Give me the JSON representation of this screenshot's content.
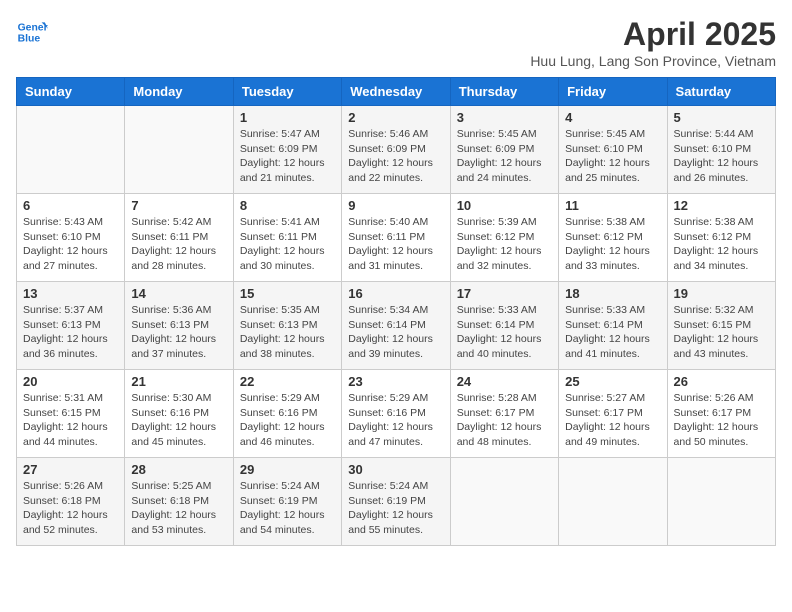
{
  "logo": {
    "line1": "General",
    "line2": "Blue"
  },
  "title": "April 2025",
  "subtitle": "Huu Lung, Lang Son Province, Vietnam",
  "weekdays": [
    "Sunday",
    "Monday",
    "Tuesday",
    "Wednesday",
    "Thursday",
    "Friday",
    "Saturday"
  ],
  "weeks": [
    [
      {
        "day": "",
        "info": ""
      },
      {
        "day": "",
        "info": ""
      },
      {
        "day": "1",
        "info": "Sunrise: 5:47 AM\nSunset: 6:09 PM\nDaylight: 12 hours and 21 minutes."
      },
      {
        "day": "2",
        "info": "Sunrise: 5:46 AM\nSunset: 6:09 PM\nDaylight: 12 hours and 22 minutes."
      },
      {
        "day": "3",
        "info": "Sunrise: 5:45 AM\nSunset: 6:09 PM\nDaylight: 12 hours and 24 minutes."
      },
      {
        "day": "4",
        "info": "Sunrise: 5:45 AM\nSunset: 6:10 PM\nDaylight: 12 hours and 25 minutes."
      },
      {
        "day": "5",
        "info": "Sunrise: 5:44 AM\nSunset: 6:10 PM\nDaylight: 12 hours and 26 minutes."
      }
    ],
    [
      {
        "day": "6",
        "info": "Sunrise: 5:43 AM\nSunset: 6:10 PM\nDaylight: 12 hours and 27 minutes."
      },
      {
        "day": "7",
        "info": "Sunrise: 5:42 AM\nSunset: 6:11 PM\nDaylight: 12 hours and 28 minutes."
      },
      {
        "day": "8",
        "info": "Sunrise: 5:41 AM\nSunset: 6:11 PM\nDaylight: 12 hours and 30 minutes."
      },
      {
        "day": "9",
        "info": "Sunrise: 5:40 AM\nSunset: 6:11 PM\nDaylight: 12 hours and 31 minutes."
      },
      {
        "day": "10",
        "info": "Sunrise: 5:39 AM\nSunset: 6:12 PM\nDaylight: 12 hours and 32 minutes."
      },
      {
        "day": "11",
        "info": "Sunrise: 5:38 AM\nSunset: 6:12 PM\nDaylight: 12 hours and 33 minutes."
      },
      {
        "day": "12",
        "info": "Sunrise: 5:38 AM\nSunset: 6:12 PM\nDaylight: 12 hours and 34 minutes."
      }
    ],
    [
      {
        "day": "13",
        "info": "Sunrise: 5:37 AM\nSunset: 6:13 PM\nDaylight: 12 hours and 36 minutes."
      },
      {
        "day": "14",
        "info": "Sunrise: 5:36 AM\nSunset: 6:13 PM\nDaylight: 12 hours and 37 minutes."
      },
      {
        "day": "15",
        "info": "Sunrise: 5:35 AM\nSunset: 6:13 PM\nDaylight: 12 hours and 38 minutes."
      },
      {
        "day": "16",
        "info": "Sunrise: 5:34 AM\nSunset: 6:14 PM\nDaylight: 12 hours and 39 minutes."
      },
      {
        "day": "17",
        "info": "Sunrise: 5:33 AM\nSunset: 6:14 PM\nDaylight: 12 hours and 40 minutes."
      },
      {
        "day": "18",
        "info": "Sunrise: 5:33 AM\nSunset: 6:14 PM\nDaylight: 12 hours and 41 minutes."
      },
      {
        "day": "19",
        "info": "Sunrise: 5:32 AM\nSunset: 6:15 PM\nDaylight: 12 hours and 43 minutes."
      }
    ],
    [
      {
        "day": "20",
        "info": "Sunrise: 5:31 AM\nSunset: 6:15 PM\nDaylight: 12 hours and 44 minutes."
      },
      {
        "day": "21",
        "info": "Sunrise: 5:30 AM\nSunset: 6:16 PM\nDaylight: 12 hours and 45 minutes."
      },
      {
        "day": "22",
        "info": "Sunrise: 5:29 AM\nSunset: 6:16 PM\nDaylight: 12 hours and 46 minutes."
      },
      {
        "day": "23",
        "info": "Sunrise: 5:29 AM\nSunset: 6:16 PM\nDaylight: 12 hours and 47 minutes."
      },
      {
        "day": "24",
        "info": "Sunrise: 5:28 AM\nSunset: 6:17 PM\nDaylight: 12 hours and 48 minutes."
      },
      {
        "day": "25",
        "info": "Sunrise: 5:27 AM\nSunset: 6:17 PM\nDaylight: 12 hours and 49 minutes."
      },
      {
        "day": "26",
        "info": "Sunrise: 5:26 AM\nSunset: 6:17 PM\nDaylight: 12 hours and 50 minutes."
      }
    ],
    [
      {
        "day": "27",
        "info": "Sunrise: 5:26 AM\nSunset: 6:18 PM\nDaylight: 12 hours and 52 minutes."
      },
      {
        "day": "28",
        "info": "Sunrise: 5:25 AM\nSunset: 6:18 PM\nDaylight: 12 hours and 53 minutes."
      },
      {
        "day": "29",
        "info": "Sunrise: 5:24 AM\nSunset: 6:19 PM\nDaylight: 12 hours and 54 minutes."
      },
      {
        "day": "30",
        "info": "Sunrise: 5:24 AM\nSunset: 6:19 PM\nDaylight: 12 hours and 55 minutes."
      },
      {
        "day": "",
        "info": ""
      },
      {
        "day": "",
        "info": ""
      },
      {
        "day": "",
        "info": ""
      }
    ]
  ]
}
